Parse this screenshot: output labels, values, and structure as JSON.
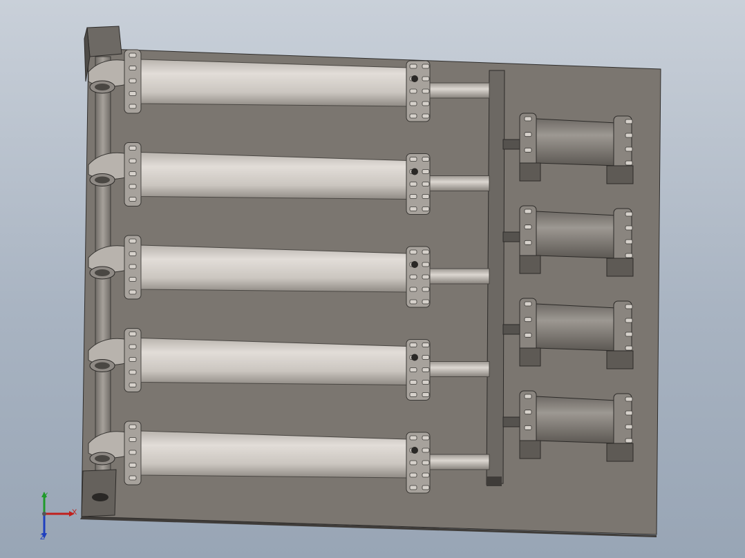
{
  "viewport": {
    "background_top": "#c9d0d9",
    "background_bottom": "#98a5b5"
  },
  "model": {
    "plate_color": "#7b7670",
    "plate_edge_color": "#4a4743",
    "cylinder_color": "#cfcac4",
    "large_cylinder_count": 5,
    "small_cylinder_count": 4
  },
  "triad": {
    "x_label": "X",
    "y_label": "Y",
    "z_label": "Z",
    "x_color": "#c0201c",
    "y_color": "#1f9a2a",
    "z_color": "#1e3fbf"
  }
}
